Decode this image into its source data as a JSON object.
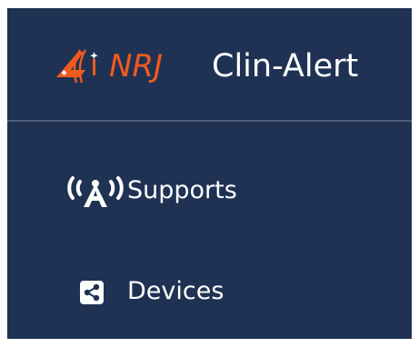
{
  "brand": {
    "logo_text": "NRJ",
    "app_name": "Clin-Alert",
    "logo_icon": "flame-logo-icon",
    "logo_color": "#f05a1e"
  },
  "colors": {
    "sidebar_bg": "#1f3253",
    "divider": "#4b5d79",
    "text": "#ffffff"
  },
  "nav": {
    "items": [
      {
        "label": "Supports",
        "icon": "broadcast-tower-icon"
      },
      {
        "label": "Devices",
        "icon": "share-square-icon"
      }
    ]
  }
}
